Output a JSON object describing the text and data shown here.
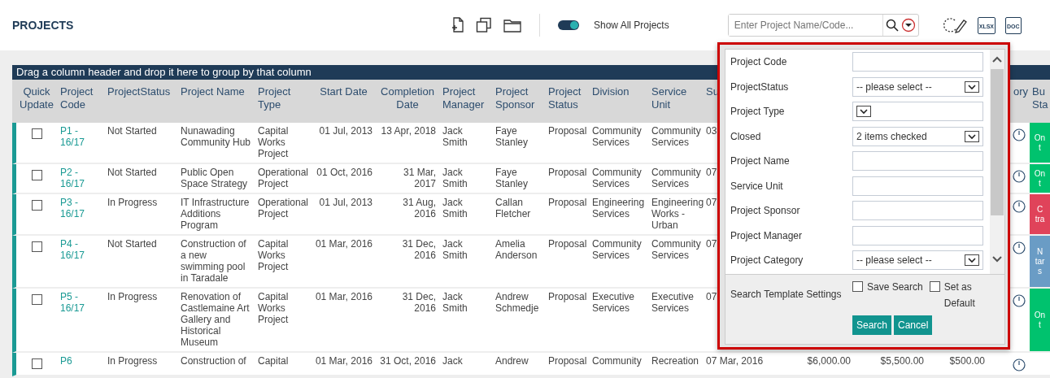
{
  "page_title": "PROJECTS",
  "toolbar": {
    "show_all": {
      "label": "Show All Projects",
      "on": true
    },
    "search": {
      "placeholder": "Enter Project Name/Code..."
    },
    "export_xlsx": "XLSX",
    "export_doc": "DOC"
  },
  "group_bar": "Drag a column header and drop it here to group by that column",
  "columns": [
    "Quick Update",
    "Project Code",
    "ProjectStatus",
    "Project Name",
    "Project Type",
    "Start Date",
    "Completion Date",
    "Project Manager",
    "Project Sponsor",
    "Project Status",
    "Division",
    "Service Unit",
    "Su",
    null,
    null,
    null,
    "ory",
    "Bu Sta"
  ],
  "rows": [
    {
      "checked": false,
      "cells": [
        "P1 - 16/17",
        "Not Started",
        "Nunawading Community Hub",
        "Capital Works Project",
        "01 Jul, 2013",
        "13 Apr, 2018",
        "Jack Smith",
        "Faye Stanley",
        "Proposal",
        "Community Services",
        "Community Services",
        "03",
        null,
        null,
        null
      ],
      "budget_status": {
        "label": "On t",
        "color": "#00c26e"
      }
    },
    {
      "checked": false,
      "cells": [
        "P2 - 16/17",
        "Not Started",
        "Public Open Space Strategy",
        "Operational Project",
        "01 Oct, 2016",
        "31 Mar, 2017",
        "Jack Smith",
        "Faye Stanley",
        "Proposal",
        "Community Services",
        "Community Services",
        "07",
        null,
        null,
        null
      ],
      "budget_status": {
        "label": "On t",
        "color": "#00c26e"
      }
    },
    {
      "checked": false,
      "cells": [
        "P3 - 16/17",
        "In Progress",
        "IT Infrastructure Additions Program",
        "Operational Project",
        "01 Jul, 2013",
        "31 Aug, 2016",
        "Jack Smith",
        "Callan Fletcher",
        "Proposal",
        "Engineering Services",
        "Engineering Works - Urban",
        "07",
        null,
        null,
        null
      ],
      "budget_status": {
        "label": "C tra",
        "color": "#e0435a"
      }
    },
    {
      "checked": false,
      "cells": [
        "P4 - 16/17",
        "Not Started",
        "Construction of a new swimming pool in Taradale",
        "Capital Works Project",
        "01 Mar, 2016",
        "31 Dec, 2016",
        "Jack Smith",
        "Amelia Anderson",
        "Proposal",
        "Community Services",
        "Community Services",
        "07",
        null,
        null,
        null
      ],
      "budget_status": {
        "label": "N tar s",
        "color": "#6a9cc5"
      }
    },
    {
      "checked": false,
      "cells": [
        "P5 - 16/17",
        "In Progress",
        "Renovation of Castlemaine Art Gallery and Historical Museum",
        "Capital Works Project",
        "01 Mar, 2016",
        "31 Dec, 2016",
        "Jack Smith",
        "Andrew Schmedje",
        "Proposal",
        "Executive Services",
        "Executive Services",
        "07",
        null,
        null,
        null
      ],
      "budget_status": {
        "label": "On t",
        "color": "#00c26e"
      }
    },
    {
      "checked": false,
      "cells": [
        "P6",
        "In Progress",
        "Construction of",
        "Capital",
        "01 Mar, 2016",
        "31 Oct, 2016",
        "Jack",
        "Andrew",
        "Proposal",
        "Community",
        "Recreation",
        "07 Mar, 2016",
        "$6,000.00",
        "$5,500.00",
        "$500.00"
      ]
    }
  ],
  "search_panel": {
    "fields": [
      {
        "label": "Project Code",
        "kind": "text"
      },
      {
        "label": "ProjectStatus",
        "kind": "select",
        "value": "-- please select --"
      },
      {
        "label": "Project Type",
        "kind": "select"
      },
      {
        "label": "Closed",
        "kind": "select",
        "value": "2 items checked"
      },
      {
        "label": "Project Name",
        "kind": "text"
      },
      {
        "label": "Service Unit",
        "kind": "text"
      },
      {
        "label": "Project Sponsor",
        "kind": "text"
      },
      {
        "label": "Project Manager",
        "kind": "text"
      },
      {
        "label": "Project Category",
        "kind": "select",
        "value": "-- please select --"
      }
    ],
    "template_label": "Search Template Settings",
    "options": [
      {
        "label": "Save Search",
        "checked": false
      },
      {
        "label": "Set as Default",
        "checked": false
      }
    ],
    "buttons": [
      "Search",
      "Cancel"
    ]
  }
}
